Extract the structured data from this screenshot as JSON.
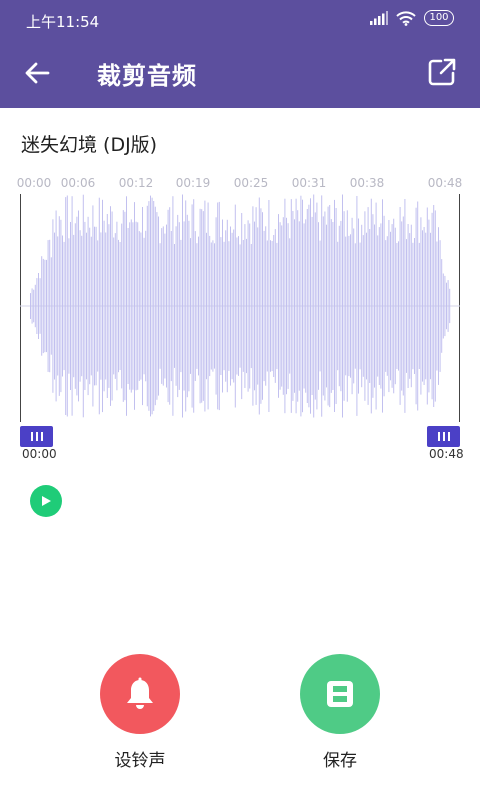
{
  "status_bar": {
    "time": "上午11:54",
    "battery": "100"
  },
  "app_bar": {
    "title": "裁剪音频",
    "back_icon": "arrow-left-icon",
    "share_icon": "external-link-icon"
  },
  "song": {
    "title": "迷失幻境 (DJ版)"
  },
  "timeline": {
    "ticks": [
      "00:00",
      "00:06",
      "00:12",
      "00:19",
      "00:25",
      "00:31",
      "00:38",
      "00:48"
    ]
  },
  "selection": {
    "start_time": "00:00",
    "end_time": "00:48"
  },
  "player": {
    "play_icon": "play-icon"
  },
  "actions": {
    "ringtone_label": "设铃声",
    "save_label": "保存"
  },
  "colors": {
    "primary": "#5c4f9e",
    "waveform": "#c2c0ef",
    "handle": "#4b40c6",
    "play": "#1fcc78",
    "ringtone": "#f2585e",
    "save": "#4fcb86"
  }
}
